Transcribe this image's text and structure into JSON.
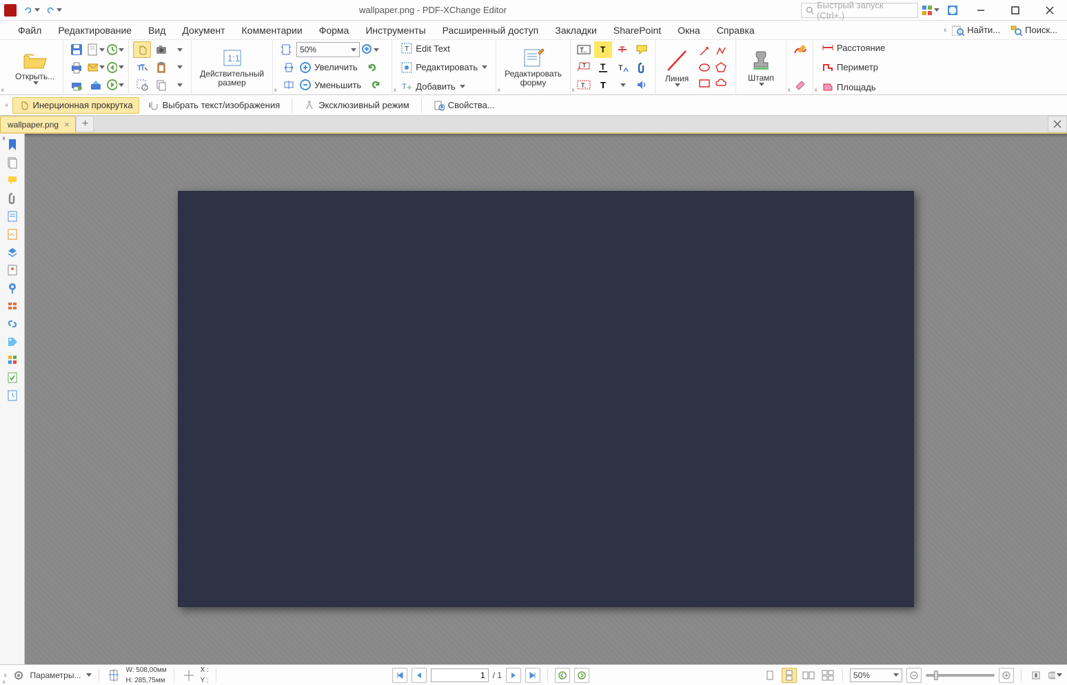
{
  "title": "wallpaper.png - PDF-XChange Editor",
  "quick_launch_placeholder": "Быстрый запуск (Ctrl+.)",
  "menus": {
    "file": "Файл",
    "edit": "Редактирование",
    "view": "Вид",
    "document": "Документ",
    "comments": "Комментарии",
    "form": "Форма",
    "tools": "Инструменты",
    "ext_access": "Расширенный доступ",
    "bookmarks": "Закладки",
    "sharepoint": "SharePoint",
    "windows": "Окна",
    "help": "Справка",
    "find": "Найти...",
    "search": "Поиск..."
  },
  "ribbon": {
    "open": "Открыть...",
    "actual_size": "Действительный\nразмер",
    "zoom_value": "50%",
    "zoom_in": "Увеличить",
    "zoom_out": "Уменьшить",
    "edit_text": "Edit Text",
    "edit": "Редактировать",
    "add": "Добавить",
    "edit_form": "Редактировать\nформу",
    "line": "Линия",
    "stamp": "Штамп",
    "distance": "Расстояние",
    "perimeter": "Периметр",
    "area": "Площадь"
  },
  "toolbar2": {
    "inertial": "Инерционная прокрутка",
    "select": "Выбрать текст/изображения",
    "exclusive": "Эксклюзивный режим",
    "props": "Свойства..."
  },
  "tab_name": "wallpaper.png",
  "status": {
    "params": "Параметры...",
    "w_label": "W:",
    "h_label": "H:",
    "w_value": "508,00мм",
    "h_value": "285,75мм",
    "x_label": "X :",
    "y_label": "Y :",
    "page_current": "1",
    "page_total": "/ 1",
    "zoom": "50%"
  }
}
